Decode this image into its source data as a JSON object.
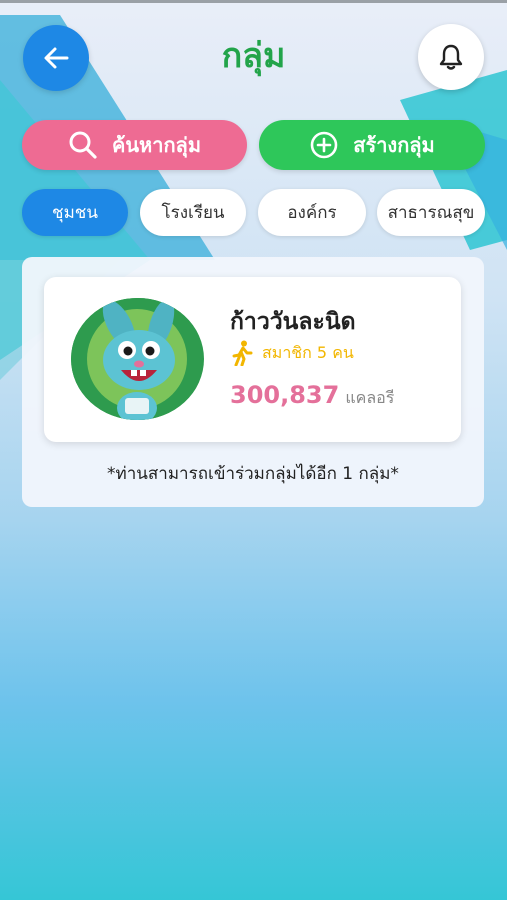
{
  "header": {
    "title": "กลุ่ม"
  },
  "actions": {
    "search_label": "ค้นหากลุ่ม",
    "create_label": "สร้างกลุ่ม"
  },
  "tabs": [
    {
      "label": "ชุมชน",
      "active": true
    },
    {
      "label": "โรงเรียน",
      "active": false
    },
    {
      "label": "องค์กร",
      "active": false
    },
    {
      "label": "สาธารณสุข",
      "active": false
    }
  ],
  "group_card": {
    "name": "ก้าววันละนิด",
    "members": "สมาชิก 5 คน",
    "calories": "300,837",
    "calories_unit": "แคลอรี"
  },
  "note": "*ท่านสามารถเข้าร่วมกลุ่มได้อีก 1 กลุ่ม*",
  "icons": {
    "back": "arrow-left-icon",
    "bell": "bell-icon",
    "search": "search-icon",
    "create": "plus-circle-icon",
    "member": "walking-person-icon"
  },
  "colors": {
    "title_green": "#22a44a",
    "primary_blue": "#1e88e5",
    "search_pink": "#ee6b93",
    "create_green": "#2ec75a",
    "member_yellow": "#f2b600",
    "calorie_pink": "#e4709a"
  }
}
